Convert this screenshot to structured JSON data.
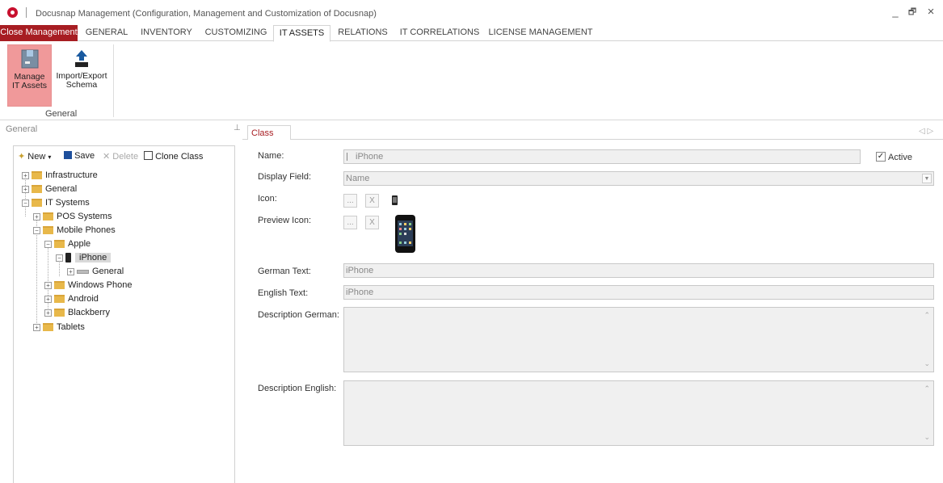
{
  "window": {
    "title": "Docusnap Management (Configuration, Management and Customization of Docusnap)",
    "minimize": "_",
    "restore": "🗗",
    "close": "×"
  },
  "tabs": [
    {
      "label": "Close Management"
    },
    {
      "label": "GENERAL"
    },
    {
      "label": "INVENTORY"
    },
    {
      "label": "CUSTOMIZING"
    },
    {
      "label": "IT ASSETS"
    },
    {
      "label": "RELATIONS"
    },
    {
      "label": "IT CORRELATIONS"
    },
    {
      "label": "LICENSE MANAGEMENT"
    }
  ],
  "active_tab": "IT ASSETS",
  "ribbon": {
    "manage_label_1": "Manage",
    "manage_label_2": "IT Assets",
    "import_label_1": "Import/Export",
    "import_label_2": "Schema",
    "group_label": "General"
  },
  "left_pane": {
    "header": "General",
    "toolbar": {
      "new": "New",
      "save": "Save",
      "delete": "Delete",
      "clone": "Clone Class"
    },
    "tree": [
      {
        "label": "Infrastructure"
      },
      {
        "label": "General"
      },
      {
        "label": "IT Systems"
      },
      {
        "label": "POS Systems"
      },
      {
        "label": "Mobile Phones"
      },
      {
        "label": "Apple"
      },
      {
        "label": "iPhone"
      },
      {
        "label": "General"
      },
      {
        "label": "Windows Phone"
      },
      {
        "label": "Android"
      },
      {
        "label": "Blackberry"
      },
      {
        "label": "Tablets"
      }
    ]
  },
  "right_pane": {
    "tab": "Class",
    "labels": {
      "name": "Name:",
      "display_field": "Display Field:",
      "icon": "Icon:",
      "preview_icon": "Preview Icon:",
      "german_text": "German Text:",
      "english_text": "English Text:",
      "description_german": "Description German:",
      "description_english": "Description English:"
    },
    "values": {
      "name": "iPhone",
      "display_field": "Name",
      "german_text": "iPhone",
      "english_text": "iPhone"
    },
    "active_label": "Active",
    "active_checked": true,
    "browse_btn": "...",
    "clear_btn": "X"
  },
  "colors": {
    "accent": "#a71d22",
    "selected_ribbon": "#f0999a"
  }
}
